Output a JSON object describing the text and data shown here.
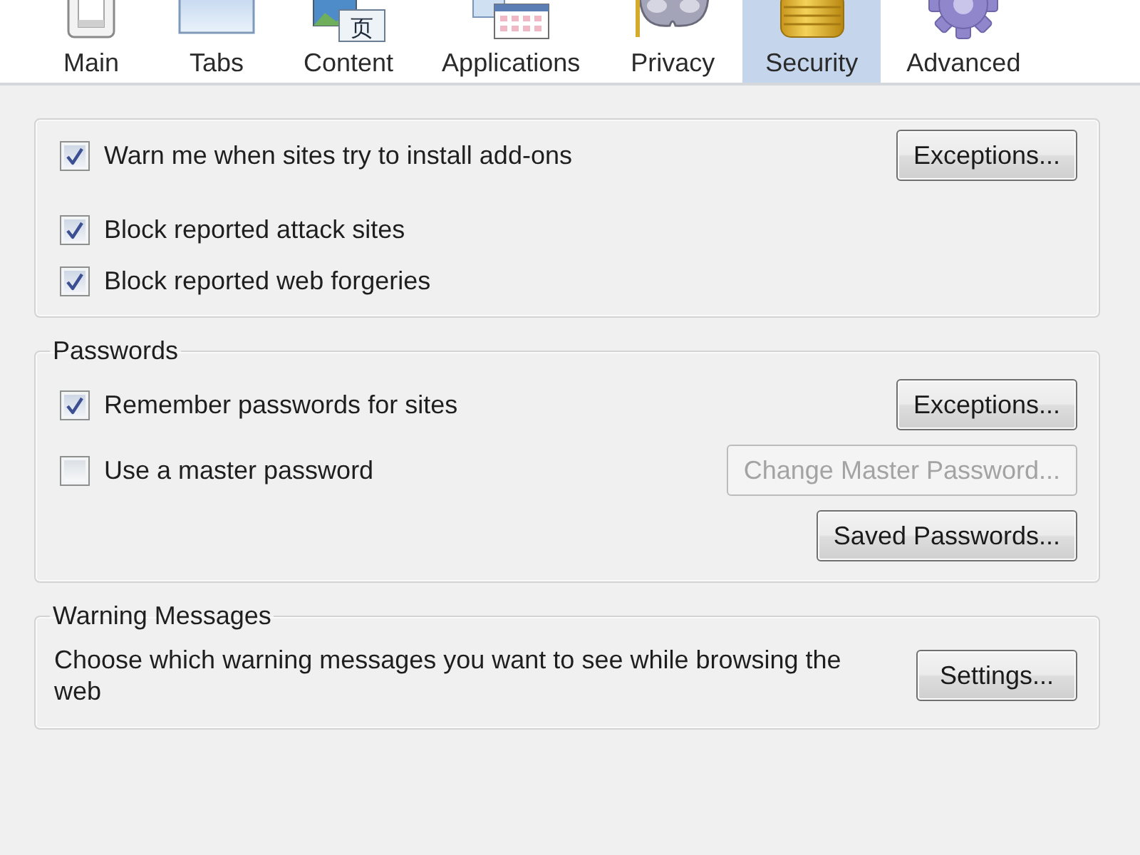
{
  "tabs": [
    {
      "label": "Main",
      "selected": false
    },
    {
      "label": "Tabs",
      "selected": false
    },
    {
      "label": "Content",
      "selected": false,
      "icon_text": "页"
    },
    {
      "label": "Applications",
      "selected": false
    },
    {
      "label": "Privacy",
      "selected": false
    },
    {
      "label": "Security",
      "selected": true
    },
    {
      "label": "Advanced",
      "selected": false
    }
  ],
  "groups": [
    {
      "rows": [
        {
          "checkbox": {
            "label": "Warn me when sites try to install add-ons",
            "checked": true
          },
          "button": {
            "label": "Exceptions...",
            "disabled": false
          }
        },
        {
          "checkbox": {
            "label": "Block reported attack sites",
            "checked": true
          }
        },
        {
          "checkbox": {
            "label": "Block reported web forgeries",
            "checked": true
          }
        }
      ]
    },
    {
      "title": "Passwords",
      "rows": [
        {
          "checkbox": {
            "label": "Remember passwords for sites",
            "checked": true
          },
          "button": {
            "label": "Exceptions...",
            "disabled": false
          }
        },
        {
          "checkbox": {
            "label": "Use a master password",
            "checked": false
          },
          "button": {
            "label": "Change Master Password...",
            "disabled": true
          }
        },
        {
          "button": {
            "label": "Saved Passwords...",
            "disabled": false
          }
        }
      ]
    },
    {
      "title": "Warning Messages",
      "rows": [
        {
          "text": "Choose which warning messages you want to see while browsing the web",
          "button": {
            "label": "Settings...",
            "disabled": false
          }
        }
      ]
    }
  ]
}
